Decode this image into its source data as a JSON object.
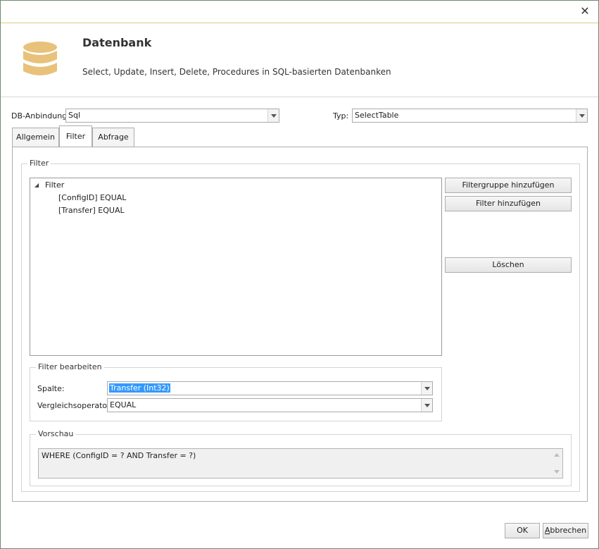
{
  "header": {
    "title": "Datenbank",
    "description": "Select, Update, Insert, Delete, Procedures in SQL-basierten Datenbanken"
  },
  "connection": {
    "db_label": "DB-Anbindung:",
    "db_value": "Sql",
    "type_label": "Typ:",
    "type_value": "SelectTable"
  },
  "tabs": [
    {
      "label": "Allgemein"
    },
    {
      "label": "Filter"
    },
    {
      "label": "Abfrage"
    }
  ],
  "filter_group": {
    "title": "Filter",
    "tree": {
      "root": "Filter",
      "children": [
        "[ConfigID] EQUAL",
        "[Transfer] EQUAL"
      ]
    },
    "add_group_label": "Filtergruppe hinzufügen",
    "add_filter_label": "Filter hinzufügen",
    "delete_label": "Löschen"
  },
  "edit_group": {
    "title": "Filter bearbeiten",
    "column_label": "Spalte:",
    "column_value": "Transfer (Int32)",
    "operator_label": "Vergleichsoperator:",
    "operator_value": "EQUAL"
  },
  "preview_group": {
    "title": "Vorschau",
    "text": "WHERE (ConfigID  = ? AND Transfer  = ?)"
  },
  "footer": {
    "ok_label": "OK",
    "cancel_first": "A",
    "cancel_rest": "bbrechen"
  },
  "colors": {
    "accent_border": "#e2c88a",
    "db_icon": "#e8c27a",
    "selection": "#3399ff"
  }
}
